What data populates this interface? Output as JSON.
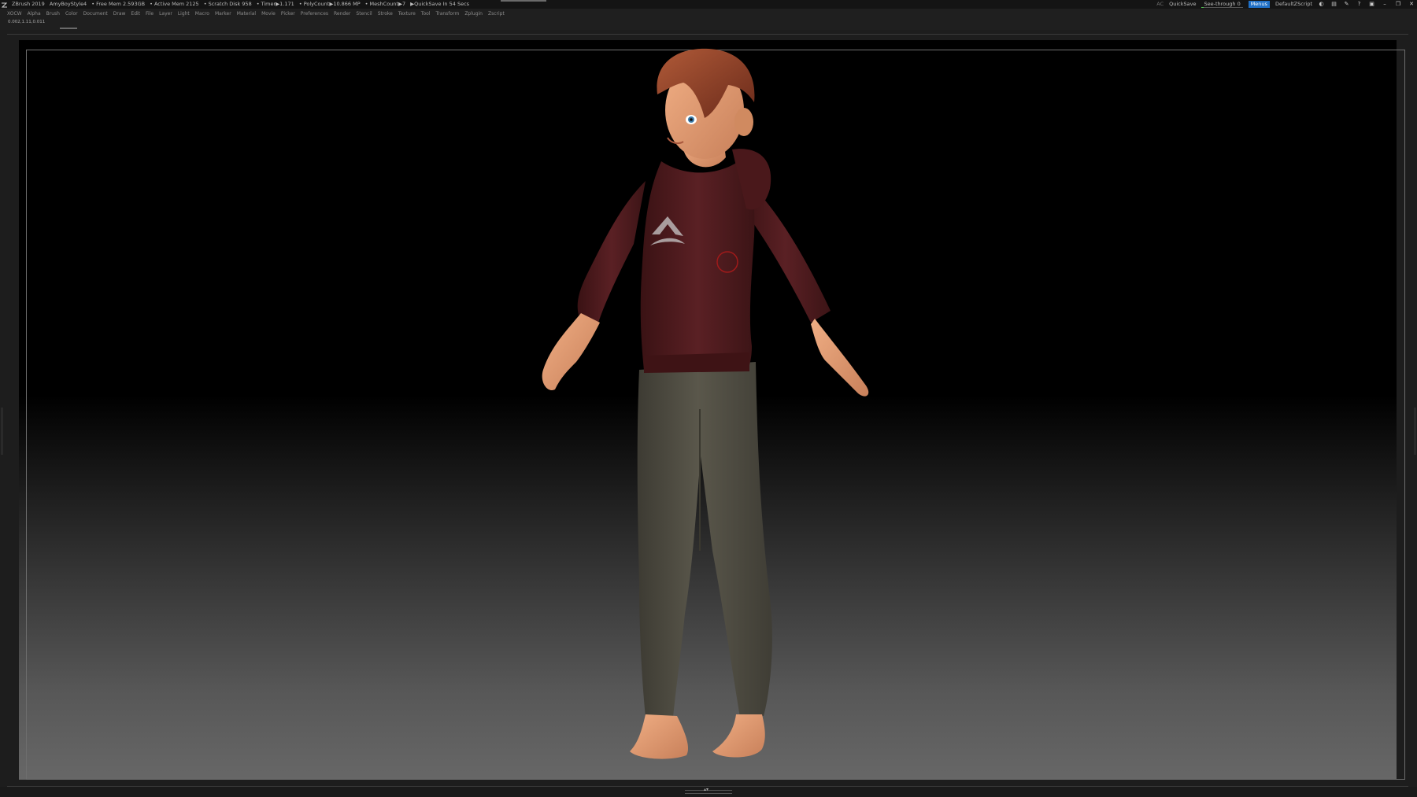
{
  "titlebar": {
    "app_name": "ZBrush 2019",
    "document_name": "AmyBoyStyle4",
    "free_mem": "• Free Mem 2.593GB",
    "active_mem": "• Active Mem 2125",
    "scratch_disk": "• Scratch Disk 958",
    "timer": "• Timer▶1.171",
    "polycount": "• PolyCount▶10.866 MP",
    "meshcount": "• MeshCount▶7",
    "quicksave_timer": "▶QuickSave In 54 Secs",
    "ac_label": "AC",
    "quicksave_button": "QuickSave",
    "see_through_label": "See-through",
    "see_through_value": "0",
    "see_through_fraction": 0.05,
    "menus_button": "Menus",
    "script_name": "DefaultZScript",
    "icons": [
      "palette-toggle-icon",
      "layout-icon",
      "brush-icon",
      "help-icon",
      "lock-icon"
    ],
    "window_buttons": [
      "minimize-icon",
      "restore-icon",
      "close-icon"
    ]
  },
  "menubar": {
    "items": [
      "XOCW",
      "Alpha",
      "Brush",
      "Color",
      "Document",
      "Draw",
      "Edit",
      "File",
      "Layer",
      "Light",
      "Macro",
      "Marker",
      "Material",
      "Movie",
      "Picker",
      "Preferences",
      "Render",
      "Stencil",
      "Stroke",
      "Texture",
      "Tool",
      "Transform",
      "Zplugin",
      "Zscript"
    ]
  },
  "infostrip": {
    "coords": "0.002,1.11,0.011"
  },
  "colors": {
    "hoodie": "#4a1a1c",
    "pants": "#4e4c42",
    "skin": "#e09a6e",
    "hair": "#8a3a24",
    "menus_accent": "#1f6fc6",
    "see_through_accent": "#4ec34e"
  }
}
